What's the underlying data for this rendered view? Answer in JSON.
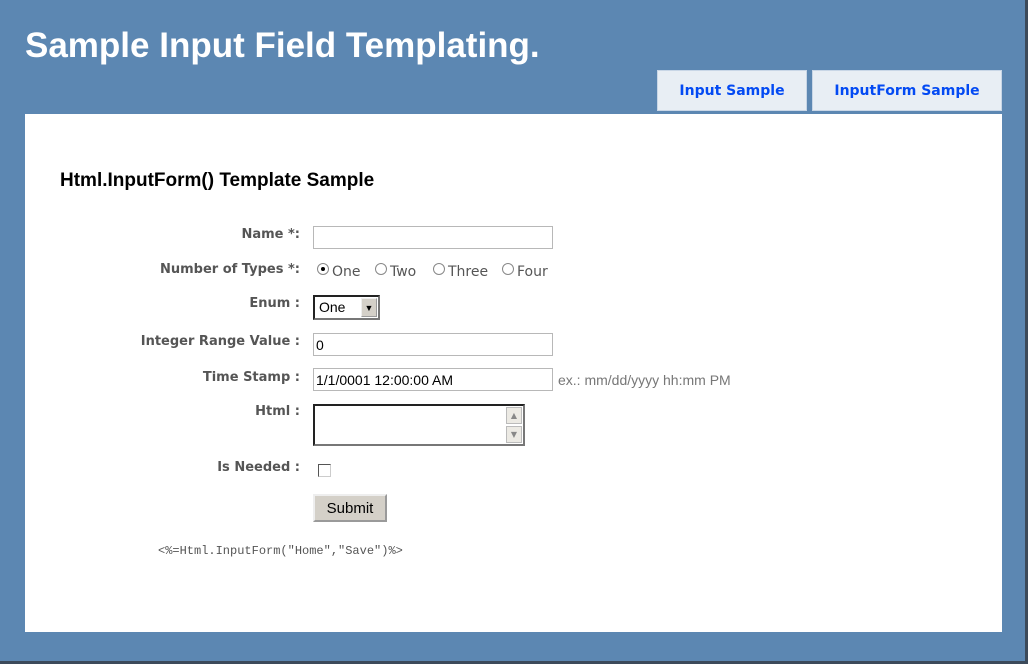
{
  "header": {
    "title": "Sample Input Field Templating."
  },
  "tabs": [
    {
      "label": "Input Sample"
    },
    {
      "label": "InputForm Sample"
    }
  ],
  "main": {
    "heading": "Html.InputForm() Template Sample",
    "fields": {
      "name": {
        "label": "Name *:",
        "value": ""
      },
      "types": {
        "label": "Number of Types *:",
        "options": [
          "One",
          "Two",
          "Three",
          "Four"
        ],
        "selected": "One"
      },
      "enum": {
        "label": "Enum :",
        "value": "One"
      },
      "integer": {
        "label": "Integer Range Value :",
        "value": "0"
      },
      "timestamp": {
        "label": "Time Stamp :",
        "value": "1/1/0001 12:00:00 AM",
        "hint": "ex.: mm/dd/yyyy hh:mm PM"
      },
      "html": {
        "label": "Html :",
        "value": ""
      },
      "needed": {
        "label": "Is Needed :",
        "checked": false
      }
    },
    "submit_label": "Submit",
    "code": "<%=Html.InputForm(\"Home\",\"Save\")%>"
  },
  "colors": {
    "background": "#5c87b2",
    "tab_bg": "#e8eef4",
    "tab_text": "#034af3"
  }
}
